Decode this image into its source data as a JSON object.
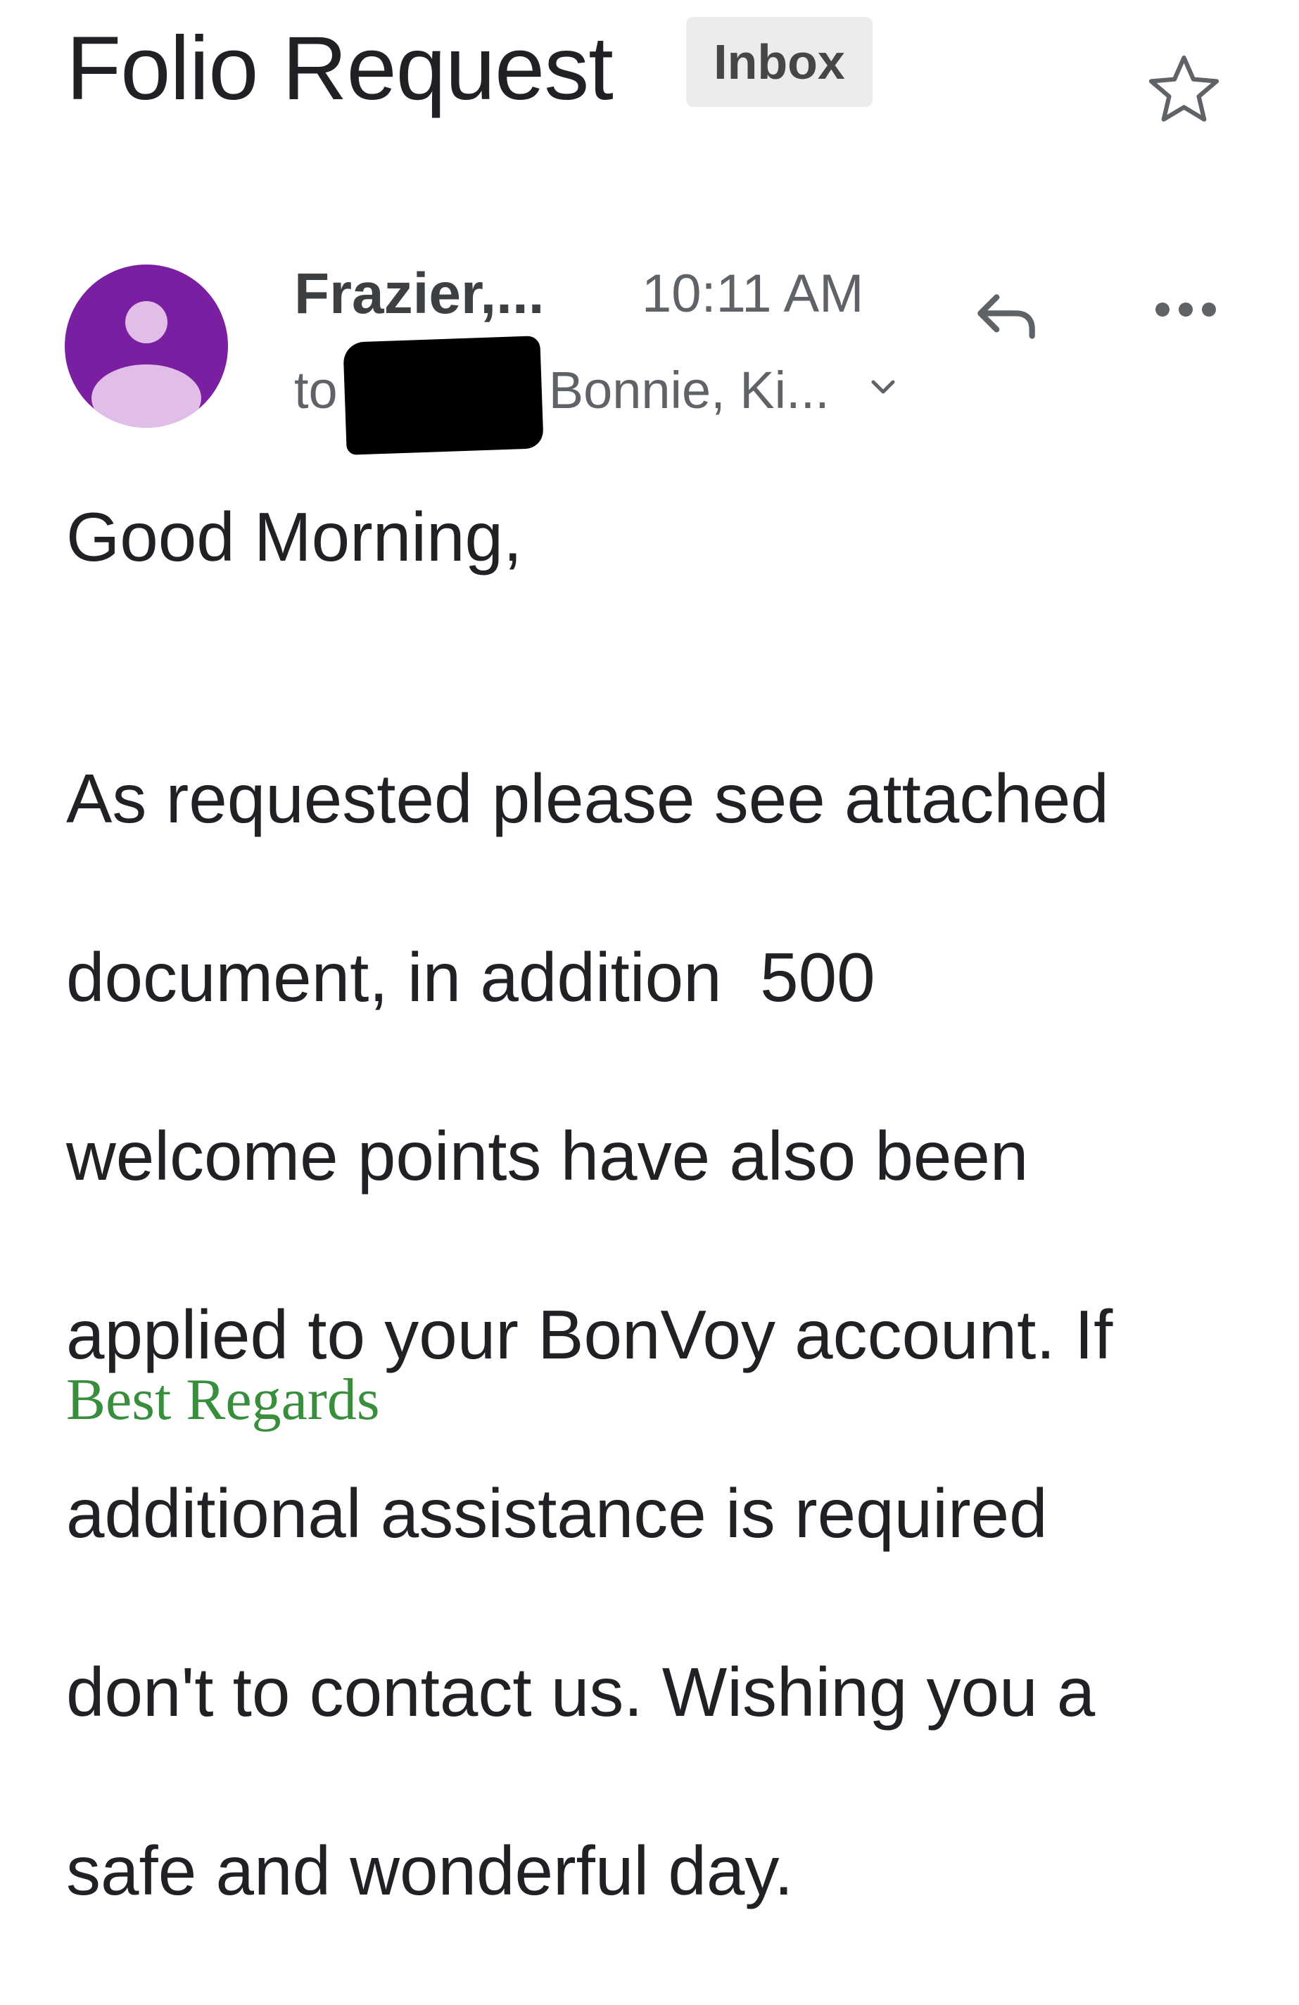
{
  "header": {
    "subject": "Folio Request",
    "label": "Inbox"
  },
  "message": {
    "sender": "Frazier,...",
    "time": "10:11 AM",
    "to_prefix": "to",
    "recipients": "Bonnie, Ki...",
    "avatar_color": "#7b1fa2"
  },
  "body": {
    "greeting": "Good Morning,",
    "lines": [
      "As requested please see attached",
      "document, in addition  500",
      "welcome points have also been",
      "applied to your BonVoy account. If",
      "additional assistance is required",
      "don't to contact us. Wishing you a",
      "safe and wonderful day."
    ],
    "signoff": "Best Regards",
    "signoff_color": "#388e3c"
  },
  "icons": {
    "star": "star-outline-icon",
    "reply": "reply-icon",
    "more": "more-horizontal-icon",
    "expand": "chevron-down-icon"
  }
}
